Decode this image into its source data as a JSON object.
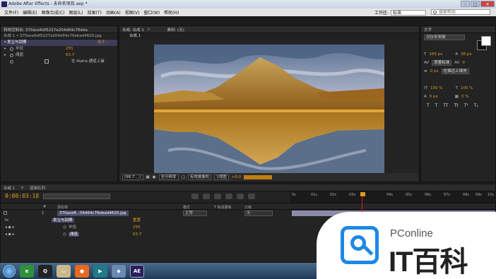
{
  "window": {
    "title": "Adobe After Effects - 未命名项目.aep *",
    "minimize": "–",
    "maximize": "□",
    "close": "✕"
  },
  "menu": [
    "文件(F)",
    "编辑(E)",
    "图像合成(C)",
    "图层(L)",
    "效果(T)",
    "动画(A)",
    "视图(V)",
    "窗口(W)",
    "帮助(H)"
  ],
  "workspace": {
    "label": "工作区:",
    "value": "标准"
  },
  "search": {
    "placeholder": "搜索帮助"
  },
  "effects_panel": {
    "tab_label": "特效控制台: 370ace6df5227a204d64c76eba",
    "source": "合成 1 • 370ace6df5227a204d64c76ebad4620.jpg",
    "effect_name": "发尘与刮擦",
    "about": "关于...",
    "props": [
      {
        "label": "半径",
        "value": "255"
      },
      {
        "label": "阈值",
        "value": "63.7"
      }
    ],
    "alpha_label": "在 Alpha 通道上操"
  },
  "comp_panel": {
    "tab": "合成: 合成 1",
    "material": "素材: (无)",
    "subtab": "合成 1",
    "controls": {
      "zoom": "(98.7 ...)",
      "quality": "全分辨率",
      "camera": "有效摄像机",
      "view": "1视图",
      "exposure": "+0.0"
    }
  },
  "text_panel": {
    "tab": "文字",
    "font": "汉仪长宋简",
    "size": "165 px",
    "leading": "36 px",
    "kerning": "度量标准",
    "tracking": "0",
    "stroke": "0 px",
    "stroke_mode": "在描边上填充",
    "vscale": "100 %",
    "hscale": "100 %",
    "baseline": "0 px",
    "tsume": "0 %",
    "format_buttons": [
      "T",
      "T",
      "TT",
      "Tt",
      "T¹",
      "T₁"
    ]
  },
  "timeline": {
    "tabs": [
      "合成 1",
      "渲染队列"
    ],
    "timecode": "0:00:03:18",
    "ruler_ticks": [
      "0s",
      "01s",
      "02s",
      "03s",
      "04s",
      "05s",
      "06s",
      "07s",
      "08s",
      "09s",
      "10s"
    ],
    "headers": {
      "num": "#",
      "source": "源名称",
      "mode": "模式",
      "trkmat": "T 轨道蒙板",
      "parent": "父级"
    },
    "layer": {
      "index": "1",
      "name": "370ace8...04d64c76ebad4620.jpg",
      "mode": "正常",
      "parent": "无"
    },
    "effect_row": {
      "fx": "fx",
      "name": "发尘与刮擦",
      "reset": "重置"
    },
    "props": [
      {
        "label": "半径",
        "value": "255"
      },
      {
        "label": "阈值",
        "value": "63.7"
      }
    ]
  },
  "taskbar": {
    "active_app": "AE"
  },
  "watermark": {
    "small": "PConline",
    "big": "IT百科"
  }
}
